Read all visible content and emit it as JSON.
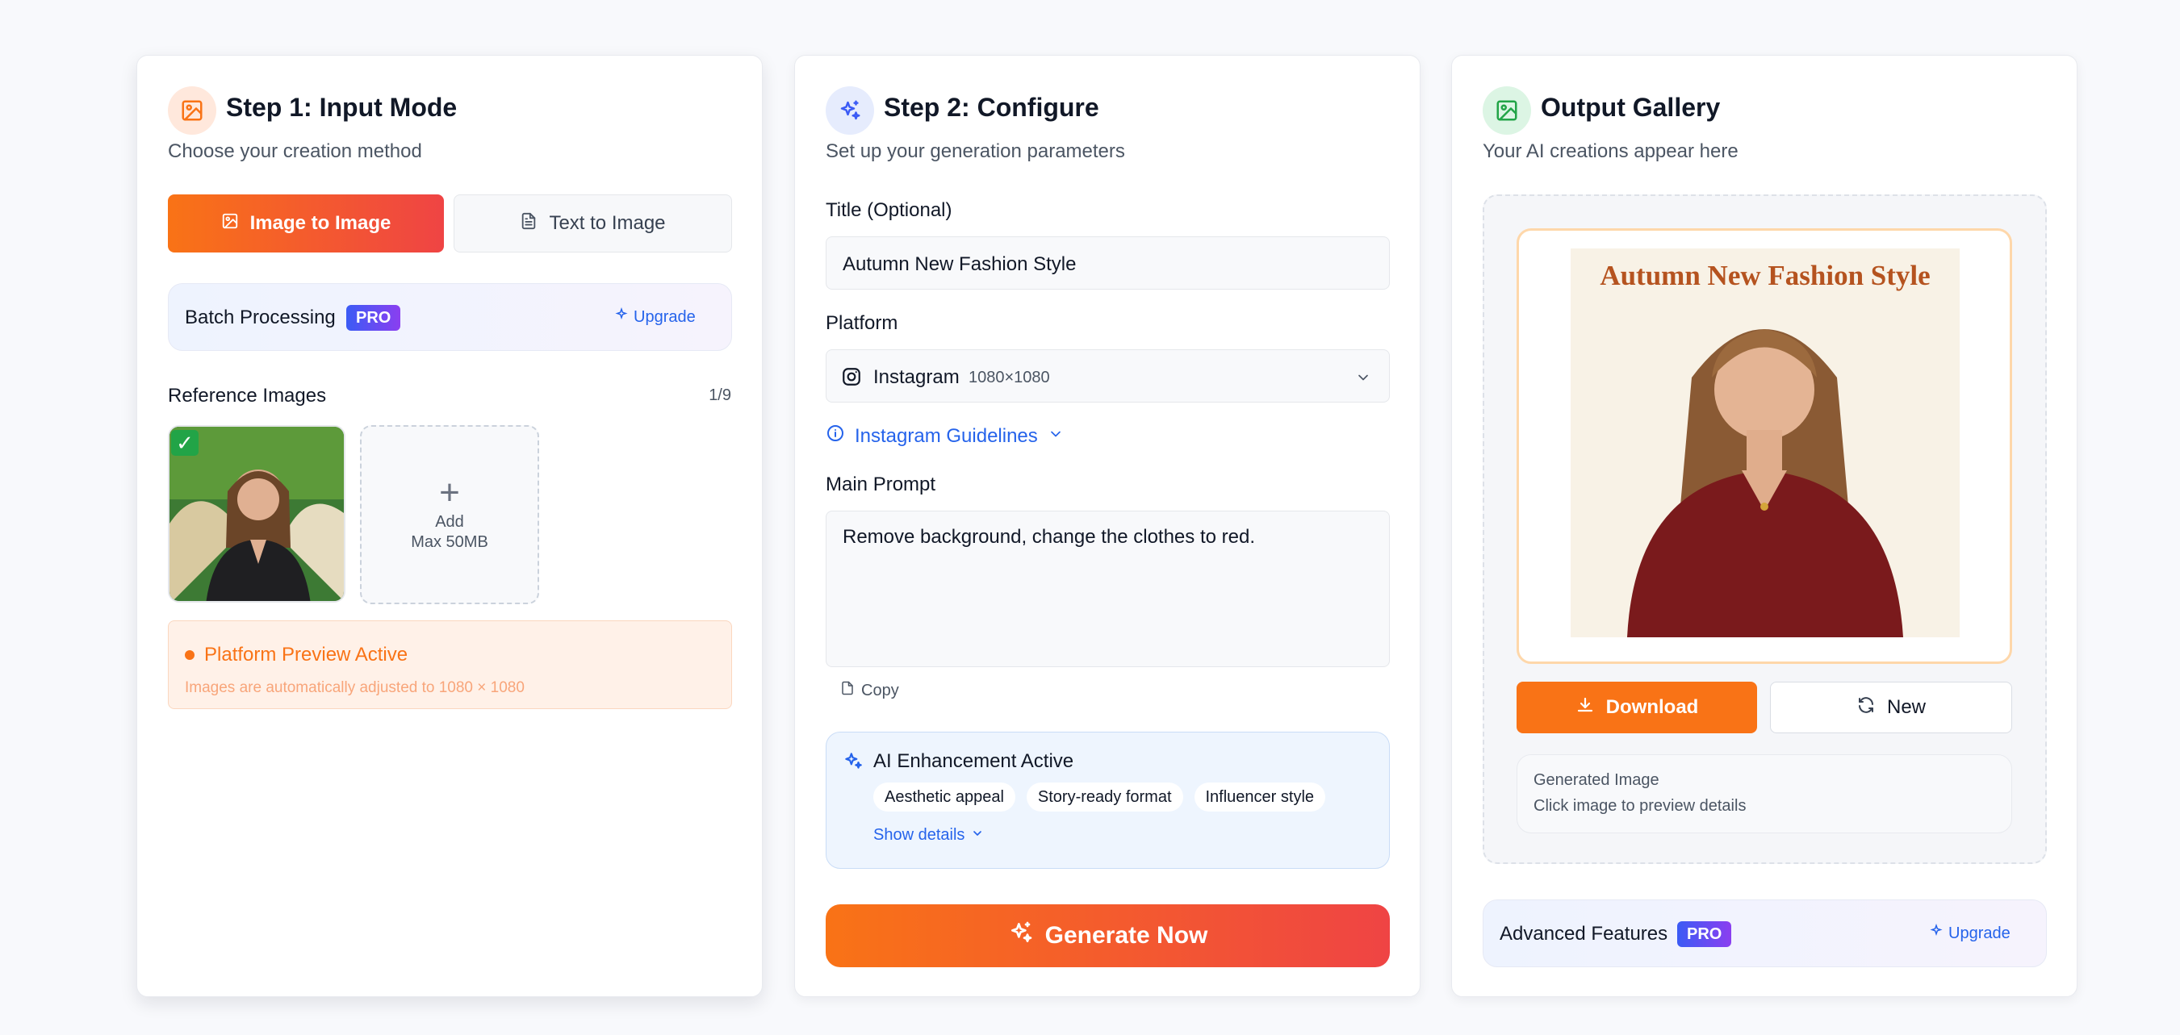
{
  "colors": {
    "accent_orange": "#f97316",
    "accent_red": "#ef4444",
    "link_blue": "#2563eb",
    "pro_gradient_start": "#3b5bf5",
    "pro_gradient_end": "#8b3ff0",
    "check_green": "#22a447"
  },
  "step1": {
    "icon": "image-icon",
    "title": "Step 1: Input Mode",
    "subtitle": "Choose your creation method",
    "modes": [
      {
        "label": "Image to Image",
        "icon": "image-icon",
        "active": true
      },
      {
        "label": "Text to Image",
        "icon": "document-icon",
        "active": false
      }
    ],
    "batch": {
      "label": "Batch Processing",
      "badge": "PRO",
      "upgrade": "Upgrade"
    },
    "reference": {
      "label": "Reference Images",
      "count": "1/9",
      "add_label": "Add",
      "add_hint": "Max 50MB",
      "check": "✓",
      "remove": "✕"
    },
    "preview": {
      "title": "Platform Preview Active",
      "text": "Images are automatically adjusted to 1080 × 1080"
    }
  },
  "step2": {
    "icon": "sparkles-icon",
    "title": "Step 2: Configure",
    "subtitle": "Set up your generation parameters",
    "title_field": {
      "label": "Title (Optional)",
      "value": "Autumn New Fashion Style"
    },
    "platform": {
      "label": "Platform",
      "name": "Instagram",
      "size": "1080×1080"
    },
    "guidelines": "Instagram Guidelines",
    "prompt": {
      "label": "Main Prompt",
      "value": "Remove background, change the clothes to red."
    },
    "copy": "Copy",
    "ai": {
      "title": "AI Enhancement Active",
      "tags": [
        "Aesthetic appeal",
        "Story-ready format",
        "Influencer style"
      ],
      "details": "Show details"
    },
    "generate": "Generate Now"
  },
  "gallery": {
    "icon": "image-icon",
    "title": "Output Gallery",
    "subtitle": "Your AI creations appear here",
    "image_caption": "Autumn New Fashion Style",
    "download": "Download",
    "new": "New",
    "info_title": "Generated Image",
    "info_text": "Click image to preview details",
    "advanced": {
      "label": "Advanced Features",
      "badge": "PRO",
      "upgrade": "Upgrade"
    }
  }
}
